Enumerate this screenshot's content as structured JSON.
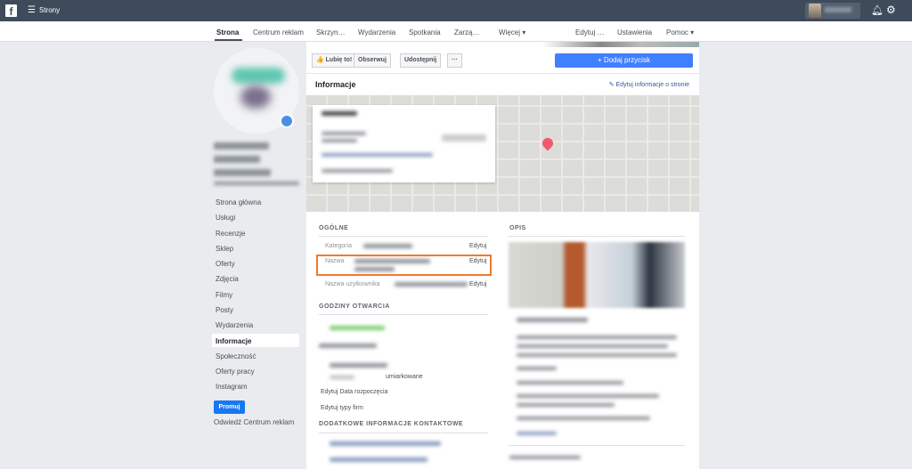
{
  "topbar": {
    "pages_label": "Strony",
    "menu_icon": "hamburger-icon",
    "bell_icon": "bell-icon",
    "gear_icon": "gear-icon"
  },
  "nav": [
    "Strona",
    "Centrum reklam",
    "Skrzyn…",
    "Wydarzenia",
    "Spotkania",
    "Zarzą…",
    "Więcej ▾",
    "Edytuj …",
    "Ustawienia",
    "Pomoc ▾"
  ],
  "sidebar": {
    "items": [
      "Strona główna",
      "Usługi",
      "Recenzje",
      "Sklep",
      "Oferty",
      "Zdjęcia",
      "Filmy",
      "Posty",
      "Wydarzenia",
      "Informacje",
      "Społeczność",
      "Oferty pracy",
      "Instagram"
    ],
    "active": "Informacje",
    "promote": "Promuj",
    "ads_center": "Odwiedź Centrum reklam"
  },
  "actions": {
    "like": "👍 Lubię to!",
    "follow": "Obserwuj",
    "share": "Udostępnij",
    "more": "···",
    "add_button": "+ Dodaj przycisk"
  },
  "info": {
    "title": "Informacje",
    "edit_link": "✎ Edytuj informacje o stronie"
  },
  "general": {
    "title": "OGÓLNE",
    "rows": [
      {
        "label": "Kategoria",
        "edit": "Edytuj"
      },
      {
        "label": "Nazwa",
        "edit": "Edytuj"
      },
      {
        "label": "Nazwa użytkownika",
        "edit": "Edytuj"
      }
    ]
  },
  "hours": {
    "title": "GODZINY OTWARCIA",
    "edit_date": "Edytuj Data rozpoczęcia",
    "edit_types": "Edytuj typy firm",
    "closed_value": "umiarkowane"
  },
  "contact": {
    "title": "DODATKOWE INFORMACJE KONTAKTOWE"
  },
  "desc": {
    "title": "OPIS"
  },
  "colors": {
    "accent": "#4080ff",
    "highlight": "#f07b2c",
    "topbar": "#3e4b5b"
  }
}
